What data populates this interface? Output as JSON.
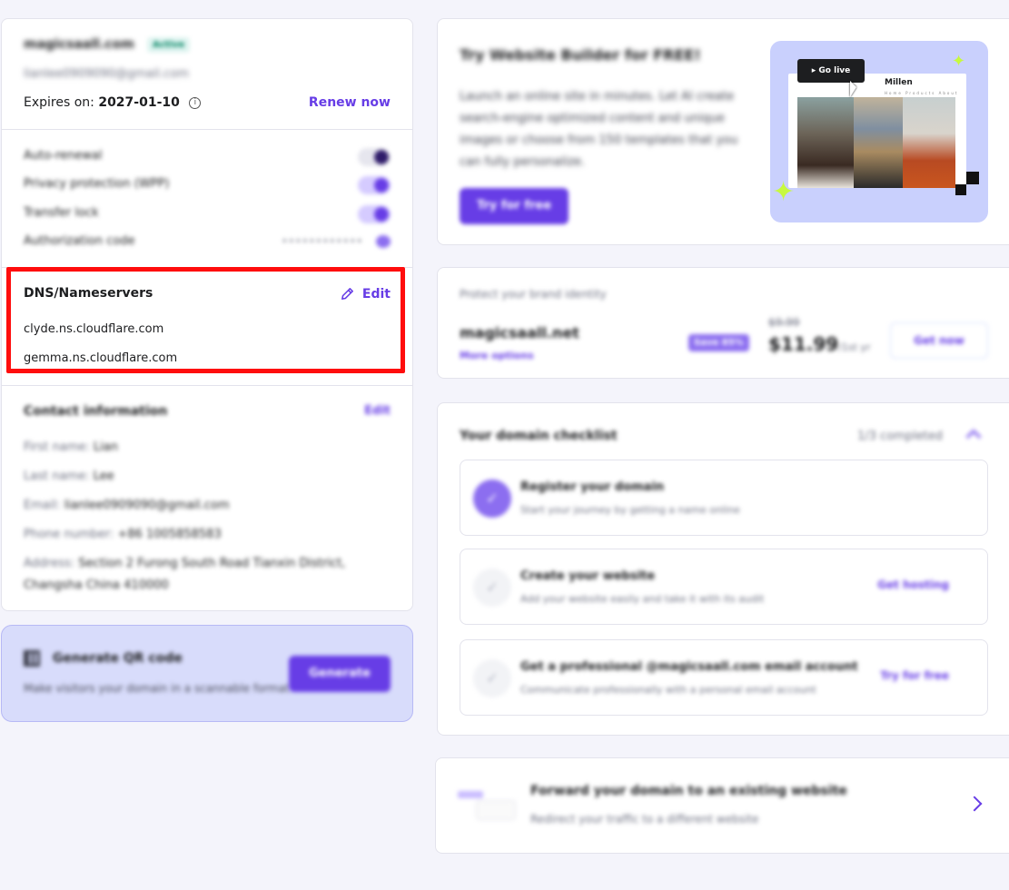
{
  "domain_card": {
    "domain": "magicsaall.com",
    "status": "Active",
    "email": "lianlee0909090@gmail.com",
    "expires_label": "Expires on:",
    "expires_date": "2027-01-10",
    "renew_label": "Renew now",
    "settings": [
      {
        "label": "Auto-renewal",
        "state": "off"
      },
      {
        "label": "Privacy protection (WPP)",
        "state": "on"
      },
      {
        "label": "Transfer lock",
        "state": "on"
      }
    ],
    "auth_code_label": "Authorization code",
    "auth_code_value": "••••••••••••"
  },
  "dns": {
    "title": "DNS/Nameservers",
    "edit_label": "Edit",
    "nameservers": [
      "clyde.ns.cloudflare.com",
      "gemma.ns.cloudflare.com"
    ]
  },
  "contact": {
    "title": "Contact information",
    "edit_label": "Edit",
    "first_name_label": "First name:",
    "first_name": "Lian",
    "last_name_label": "Last name:",
    "last_name": "Lee",
    "email_label": "Email:",
    "email": "lianlee0909090@gmail.com",
    "phone_label": "Phone number:",
    "phone": "+86 1005858583",
    "address_label": "Address:",
    "address_line1": "Section 2 Furong South Road Tianxin District,",
    "address_line2": "Changsha China 410000"
  },
  "qr": {
    "title": "Generate QR code",
    "subtitle": "Make visitors your domain in a scannable format",
    "button": "Generate"
  },
  "builder": {
    "title": "Try Website Builder for FREE!",
    "text": "Launch an online site in minutes. Let AI create search-engine optimized content and unique images or choose from 150 templates that you can fully personalize.",
    "button": "Try for free",
    "preview": {
      "go_live": "Go live",
      "brand": "Millen",
      "nav": "Home  Products  About"
    }
  },
  "upsell": {
    "caption": "Protect your brand identity",
    "domain": "magicsaall.net",
    "more": "More options",
    "badge": "Save 85%",
    "old_price": "$9.99",
    "price": "$11.99",
    "period": "/1st yr",
    "button": "Get now"
  },
  "checklist": {
    "title": "Your domain checklist",
    "count": "1/3 completed",
    "items": [
      {
        "title": "Register your domain",
        "subtitle": "Start your journey by getting a name online",
        "action": "",
        "done": true
      },
      {
        "title": "Create your website",
        "subtitle": "Add your website easily and take it with its audit",
        "action": "Get hosting",
        "done": false
      },
      {
        "title": "Get a professional @magicsaall.com email account",
        "subtitle": "Communicate professionally with a personal email account",
        "action": "Try for free",
        "done": false
      }
    ]
  },
  "forward": {
    "title": "Forward your domain to an existing website",
    "subtitle": "Redirect your traffic to a different website"
  }
}
